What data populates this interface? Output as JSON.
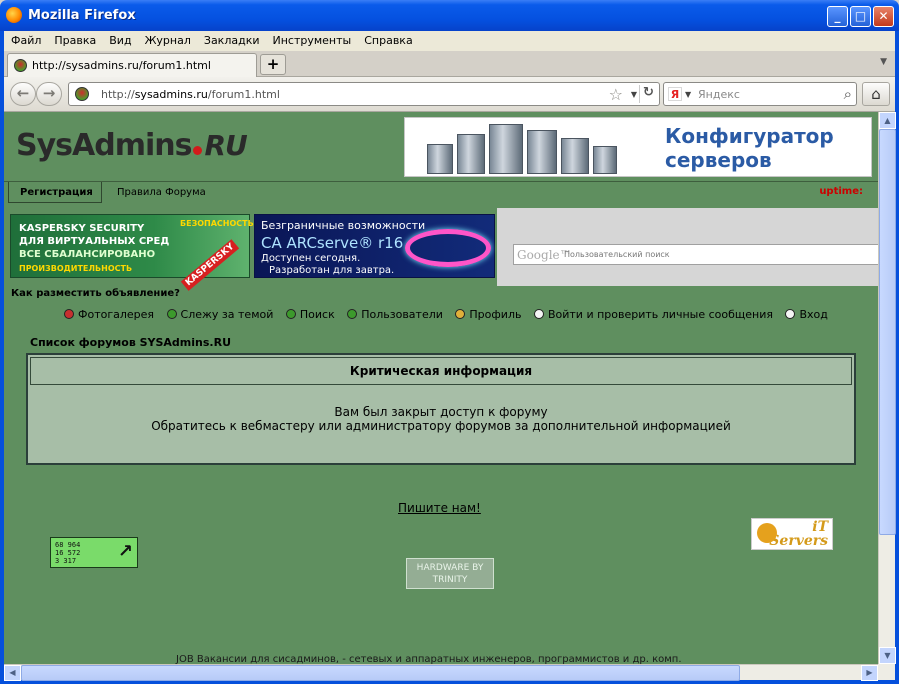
{
  "window": {
    "title": "Mozilla Firefox"
  },
  "menu": [
    "Файл",
    "Правка",
    "Вид",
    "Журнал",
    "Закладки",
    "Инструменты",
    "Справка"
  ],
  "tab": {
    "label": "http://sysadmins.ru/forum1.html",
    "new_tab": "+"
  },
  "nav": {
    "url_prefix": "http://",
    "url_host": "sysadmins.ru",
    "url_path": "/forum1.html",
    "search_placeholder": "Яндекс",
    "search_engine_letter": "Я"
  },
  "page": {
    "logo": {
      "sys": "Sys",
      "admins": "Admins",
      "ru": "RU"
    },
    "banner_top": {
      "line1": "Конфигуратор",
      "line2": "серверов"
    },
    "registration": "Регистрация",
    "rules": "Правила Форума",
    "uptime": "uptime:",
    "ad_kaspersky": {
      "line1": "KASPERSKY SECURITY",
      "line2": "ДЛЯ ВИРТУАЛЬНЫХ СРЕД",
      "line3": "ВСЕ СБАЛАНСИРОВАНО",
      "line4": "ПРОИЗВОДИТЕЛЬНОСТЬ",
      "line5": "БЕЗОПАСНОСТЬ",
      "brand": "KASPERSKY"
    },
    "ad_ca": {
      "line1": "Безграничные возможности",
      "line2": "CA ARCserve® r16",
      "line3": "Доступен сегодня.",
      "line4": "Разработан для завтра."
    },
    "google_search": {
      "brand": "Google™",
      "placeholder": "Пользовательский поиск"
    },
    "howto": "Как разместить объявление?",
    "links": [
      {
        "label": "Фотогалерея",
        "color": "#c62f2f"
      },
      {
        "label": "Слежу за темой",
        "color": "#3c9a2c"
      },
      {
        "label": "Поиск",
        "color": "#3c9a2c"
      },
      {
        "label": "Пользователи",
        "color": "#3c9a2c"
      },
      {
        "label": "Профиль",
        "color": "#e0b03a"
      },
      {
        "label": "Войти и проверить личные сообщения",
        "color": "#f5f5f5"
      },
      {
        "label": "Вход",
        "color": "#f5f5f5"
      }
    ],
    "forum_list": "Список форумов SYSAdmins.RU",
    "info_title": "Критическая информация",
    "info_line1": "Вам был закрыт доступ к форуму",
    "info_line2": "Обратитесь к вебмастеру или администратору форумов за дополнительной информацией",
    "write_us": "Пишите нам!",
    "counter": {
      "v1": "68 964",
      "v2": "16 572",
      "v3": "3 317"
    },
    "hardware": {
      "line1": "HARDWARE BY",
      "line2": "TRINITY"
    },
    "it_servers": {
      "line1": "iT",
      "line2": "Servers"
    },
    "footer": "JOB Вакансии для сисадминов, - сетевых и аппаратных инженеров, программистов и др. комп."
  },
  "colors": {
    "page_bg": "#5f8f5f",
    "accent": "#c00000"
  }
}
